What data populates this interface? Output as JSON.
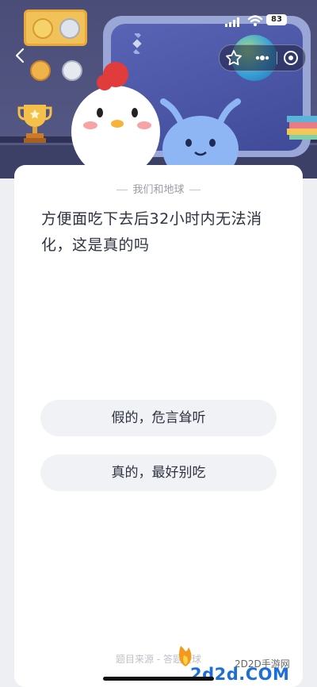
{
  "status_bar": {
    "battery": "83"
  },
  "card": {
    "header": "我们和地球",
    "question": "方便面吃下去后32小时内无法消化，这是真的吗",
    "options": [
      {
        "label": "假的，危言耸听"
      },
      {
        "label": "真的，最好别吃"
      }
    ],
    "source": "题目来源 - 答题星球"
  },
  "watermark": {
    "small": "2D2D手游网",
    "big": "2d2d.COM"
  },
  "icons": [
    "back-icon",
    "star-icon",
    "more-icon",
    "target-icon"
  ],
  "colors": {
    "hero_bg": "#4a4d78",
    "card_bg": "#ffffff",
    "option_bg": "#f1f2f5",
    "text": "#2e3342"
  }
}
